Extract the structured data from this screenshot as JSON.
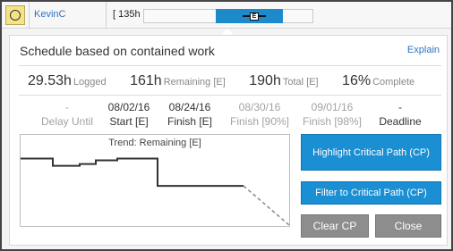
{
  "row": {
    "user_name": "KevinC",
    "hours_text": "[ 135h"
  },
  "popup": {
    "title": "Schedule based on contained work",
    "explain_label": "Explain",
    "stats": [
      {
        "value": "29.53h",
        "unit": "Logged"
      },
      {
        "value": "161h",
        "unit": "Remaining [E]"
      },
      {
        "value": "190h",
        "unit": "Total [E]"
      },
      {
        "value": "16%",
        "unit": "Complete"
      }
    ],
    "dates": [
      {
        "value": "-",
        "label": "Delay Until",
        "muted": true
      },
      {
        "value": "08/02/16",
        "label": "Start [E]",
        "muted": false
      },
      {
        "value": "08/24/16",
        "label": "Finish [E]",
        "muted": false
      },
      {
        "value": "08/30/16",
        "label": "Finish [90%]",
        "muted": true
      },
      {
        "value": "09/01/16",
        "label": "Finish [98%]",
        "muted": true
      },
      {
        "value": "-",
        "label": "Deadline",
        "muted": false
      }
    ],
    "trend_title": "Trend: Remaining [E]",
    "buttons": {
      "highlight": "Highlight Critical Path (CP)",
      "filter": "Filter to Critical Path (CP)",
      "clear": "Clear CP",
      "close": "Close"
    }
  },
  "chart_data": {
    "type": "line",
    "title": "Trend: Remaining [E]",
    "series": [
      {
        "values": [
          0.26,
          0.26,
          0.34,
          0.34,
          0.32,
          0.32,
          0.28,
          0.28,
          0.26,
          0.26,
          0.56,
          0.56
        ],
        "style": "solid"
      },
      {
        "values": [
          0.56,
          1.0
        ],
        "style": "dashed"
      }
    ],
    "colors": {
      "actual": "#333333",
      "projection": "#888888"
    }
  }
}
